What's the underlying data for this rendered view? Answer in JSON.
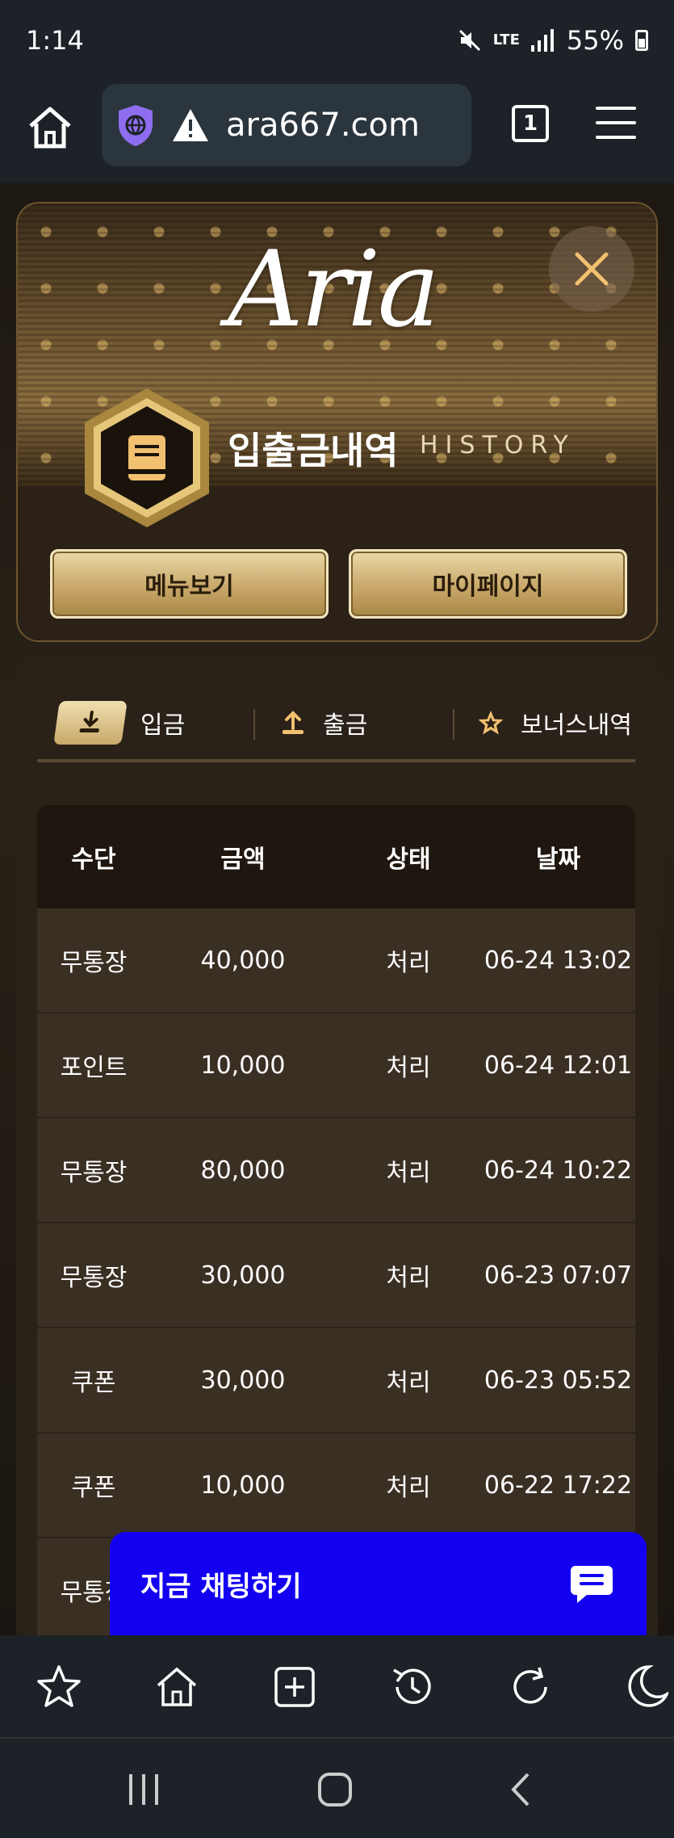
{
  "status": {
    "time": "1:14",
    "network": "LTE",
    "battery": "55%"
  },
  "browser": {
    "url": "ara667.com",
    "tab_count": "1"
  },
  "header": {
    "logo": "Aria",
    "title": "입출금내역",
    "subtitle": "HISTORY",
    "menu_button": "메뉴보기",
    "mypage_button": "마이페이지"
  },
  "tabs": [
    {
      "label": "입금",
      "icon": "download-icon",
      "active": true
    },
    {
      "label": "출금",
      "icon": "upload-icon",
      "active": false
    },
    {
      "label": "보너스내역",
      "icon": "star-icon",
      "active": false
    }
  ],
  "table": {
    "columns": [
      "수단",
      "금액",
      "상태",
      "날짜"
    ],
    "rows": [
      {
        "method": "무통장",
        "amount": "40,000",
        "status": "처리",
        "date": "06-24 13:02"
      },
      {
        "method": "포인트",
        "amount": "10,000",
        "status": "처리",
        "date": "06-24 12:01"
      },
      {
        "method": "무통장",
        "amount": "80,000",
        "status": "처리",
        "date": "06-24 10:22"
      },
      {
        "method": "무통장",
        "amount": "30,000",
        "status": "처리",
        "date": "06-23 07:07"
      },
      {
        "method": "쿠폰",
        "amount": "30,000",
        "status": "처리",
        "date": "06-23 05:52"
      },
      {
        "method": "쿠폰",
        "amount": "10,000",
        "status": "처리",
        "date": "06-22 17:22"
      },
      {
        "method": "무통장",
        "amount": "",
        "status": "",
        "date": ""
      }
    ]
  },
  "chat": {
    "label": "지금 채팅하기"
  },
  "colors": {
    "accent_gold": "#c9a86a",
    "chat_blue": "#1300f0",
    "panel_bg": "#2a2118"
  }
}
